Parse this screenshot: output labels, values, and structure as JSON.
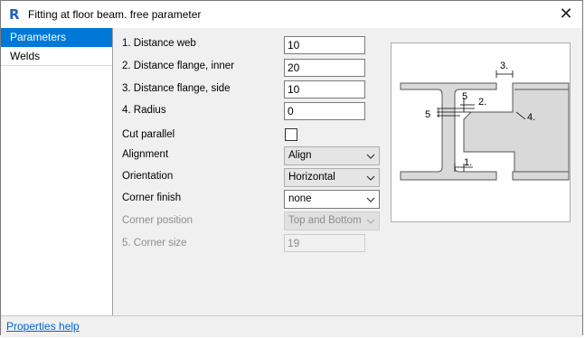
{
  "window": {
    "title": "Fitting at floor beam. free parameter",
    "icon": "revit-r-icon"
  },
  "sidebar": {
    "items": [
      {
        "label": "Parameters",
        "selected": true
      },
      {
        "label": "Welds",
        "selected": false
      }
    ]
  },
  "form": {
    "distance_web": {
      "label": "1. Distance web",
      "value": "10"
    },
    "distance_flange_inner": {
      "label": "2. Distance flange, inner",
      "value": "20"
    },
    "distance_flange_side": {
      "label": "3. Distance flange, side",
      "value": "10"
    },
    "radius": {
      "label": "4. Radius",
      "value": "0"
    },
    "cut_parallel": {
      "label": "Cut parallel",
      "checked": false
    },
    "alignment": {
      "label": "Alignment",
      "value": "Align"
    },
    "orientation": {
      "label": "Orientation",
      "value": "Horizontal"
    },
    "corner_finish": {
      "label": "Corner finish",
      "value": "none"
    },
    "corner_position": {
      "label": "Corner position",
      "value": "Top and Bottom",
      "enabled": false
    },
    "corner_size": {
      "label": "5. Corner size",
      "value": "19",
      "enabled": false
    }
  },
  "diagram": {
    "labels": {
      "d1": "1.",
      "d2": "2.",
      "d3": "3.",
      "d4": "4.",
      "d5a": "5",
      "d5b": "5"
    }
  },
  "footer": {
    "help_link": "Properties help"
  },
  "colors": {
    "accent": "#0078d7",
    "link": "#0066cc",
    "steel_fill": "#d9d9d9"
  }
}
